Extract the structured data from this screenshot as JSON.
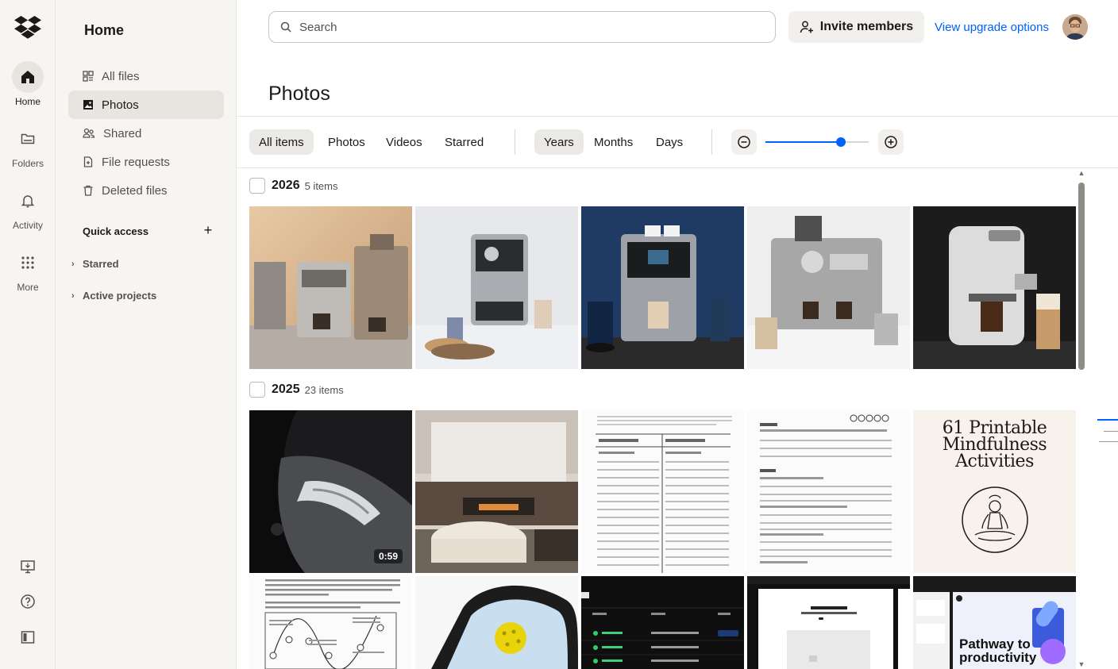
{
  "rail": {
    "items": [
      {
        "label": "Home",
        "icon": "home-icon"
      },
      {
        "label": "Folders",
        "icon": "folder-icon"
      },
      {
        "label": "Activity",
        "icon": "bell-icon"
      },
      {
        "label": "More",
        "icon": "grid-icon"
      }
    ],
    "bottom_icons": [
      "desktop-app-icon",
      "help-icon",
      "panel-toggle-icon"
    ]
  },
  "sidebar": {
    "title": "Home",
    "items": [
      {
        "label": "All files",
        "icon": "all-files-icon"
      },
      {
        "label": "Photos",
        "icon": "photos-icon"
      },
      {
        "label": "Shared",
        "icon": "shared-icon"
      },
      {
        "label": "File requests",
        "icon": "file-request-icon"
      },
      {
        "label": "Deleted files",
        "icon": "trash-icon"
      }
    ],
    "quick_access": {
      "title": "Quick access",
      "add": "+",
      "items": [
        {
          "label": "Starred"
        },
        {
          "label": "Active projects"
        }
      ]
    }
  },
  "header": {
    "search_placeholder": "Search",
    "invite_label": "Invite members",
    "upgrade_label": "View upgrade options"
  },
  "page": {
    "title": "Photos"
  },
  "toolbar": {
    "filters": [
      "All items",
      "Photos",
      "Videos",
      "Starred"
    ],
    "periods": [
      "Years",
      "Months",
      "Days"
    ],
    "zoom_level": 0.73
  },
  "sections": [
    {
      "year": "2026",
      "count": "5 items"
    },
    {
      "year": "2025",
      "count": "23 items"
    }
  ],
  "media": {
    "video_duration": "0:59",
    "mindfulness_title_1": "61 Printable",
    "mindfulness_title_2": "Mindfulness",
    "mindfulness_title_3": "Activities",
    "pathway_title_1": "Pathway to",
    "pathway_title_2": "productivity"
  },
  "colors": {
    "accent": "#0061fe",
    "sidebar_bg": "#f7f5f2",
    "text": "#1e1919"
  }
}
